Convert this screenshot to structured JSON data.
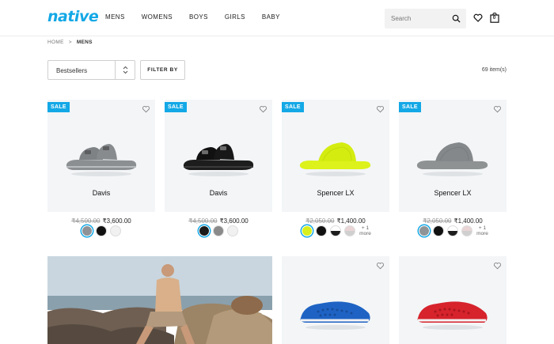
{
  "brand": {
    "logo_text": "native",
    "accent_color": "#13a8e6"
  },
  "nav": {
    "items": [
      "MENS",
      "WOMENS",
      "BOYS",
      "GIRLS",
      "BABY"
    ]
  },
  "search": {
    "placeholder": "Search",
    "icon": "search-icon"
  },
  "header_icons": {
    "wishlist": "heart-icon",
    "cart": "cart-icon",
    "cart_count": "0"
  },
  "breadcrumb": {
    "home": "HOME",
    "separator": ">",
    "current": "MENS"
  },
  "toolbar": {
    "sort_value": "Bestsellers",
    "filter_label": "FILTER BY",
    "item_count": "69 item(s)"
  },
  "products": [
    {
      "badge": "SALE",
      "name": "Davis",
      "old_price": "₹4,500.00",
      "price": "₹3,600.00",
      "color_main": "#8e9092",
      "swatches": [
        "#8e9296",
        "#111111",
        "#f1f1f1"
      ],
      "selected": 0,
      "more": ""
    },
    {
      "badge": "SALE",
      "name": "Davis",
      "old_price": "₹4,500.00",
      "price": "₹3,600.00",
      "color_main": "#1b1b1b",
      "swatches": [
        "#1a1a1a",
        "#8a8a8a",
        "#f1f1f1"
      ],
      "selected": 0,
      "more": ""
    },
    {
      "badge": "SALE",
      "name": "Spencer LX",
      "old_price": "₹2,050.00",
      "price": "₹1,400.00",
      "color_main": "#dcf21a",
      "swatches": [
        "#d8ef1c",
        "#111111",
        "#1d1d1d",
        "#e9d4d6"
      ],
      "selected": 0,
      "more": "+ 1 more"
    },
    {
      "badge": "SALE",
      "name": "Spencer LX",
      "old_price": "₹2,050.00",
      "price": "₹1,400.00",
      "color_main": "#8f9293",
      "swatches": [
        "#8f9496",
        "#111111",
        "#1d1d1d",
        "#e9d4d6"
      ],
      "selected": 0,
      "more": "+ 1 more"
    }
  ],
  "products_row2": [
    {
      "color_main": "#1e63c4"
    },
    {
      "color_main": "#d6232c"
    }
  ]
}
